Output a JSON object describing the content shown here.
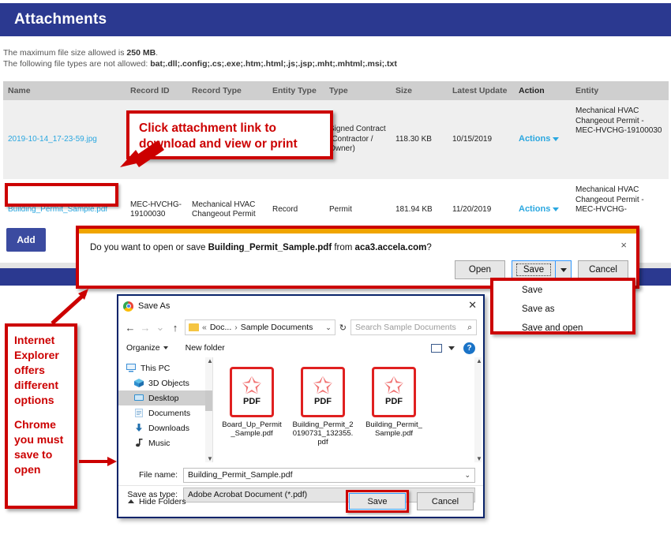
{
  "header": {
    "title": "Attachments"
  },
  "notice": {
    "line1_pre": "The maximum file size allowed is ",
    "line1_bold": "250 MB",
    "line1_post": ".",
    "line2_pre": "The following file types are not allowed: ",
    "line2_bold": "bat;.dll;.config;.cs;.exe;.htm;.html;.js;.jsp;.mht;.mhtml;.msi;.txt"
  },
  "table": {
    "columns": [
      "Name",
      "Record ID",
      "Record Type",
      "Entity Type",
      "Type",
      "Size",
      "Latest Update",
      "Action",
      "Entity"
    ],
    "rows": [
      {
        "name": "2019-10-14_17-23-59.jpg",
        "record_id": "",
        "record_type": "",
        "entity_type": "",
        "type": "Signed Contract (Contractor / Owner)",
        "size": "118.30 KB",
        "latest_update": "10/15/2019",
        "action": "Actions",
        "entity": "Mechanical HVAC Changeout Permit - MEC-HVCHG-19100030"
      },
      {
        "name": "Building_Permit_Sample.pdf",
        "record_id": "MEC-HVCHG-19100030",
        "record_type": "Mechanical HVAC Changeout Permit",
        "entity_type": "Record",
        "type": "Permit",
        "size": "181.94 KB",
        "latest_update": "11/20/2019",
        "action": "Actions",
        "entity": "Mechanical HVAC Changeout Permit - MEC-HVCHG-"
      }
    ]
  },
  "add_button": {
    "label": "Add"
  },
  "download_bar": {
    "message_pre": "Do you want to open or save ",
    "message_file": "Building_Permit_Sample.pdf",
    "message_mid": " from ",
    "message_host": "aca3.accela.com",
    "message_post": "?",
    "close_icon": "×",
    "open_label": "Open",
    "save_label": "Save",
    "cancel_label": "Cancel"
  },
  "save_menu": {
    "items": [
      "Save",
      "Save as",
      "Save and open"
    ]
  },
  "save_as": {
    "title": "Save As",
    "close_icon": "✕",
    "nav": {
      "back": "←",
      "forward": "→",
      "recent": "⌄",
      "up": "↑",
      "breadcrumb_sep1": "«",
      "breadcrumb_1": "Doc...",
      "breadcrumb_sep2": "›",
      "breadcrumb_2": "Sample Documents",
      "dropdown": "⌄",
      "refresh": "↻",
      "search_placeholder": "Search Sample Documents",
      "search_icon": "⌕"
    },
    "toolbar": {
      "organize": "Organize",
      "new_folder": "New folder",
      "help": "?"
    },
    "sidebar": [
      {
        "label": "This PC",
        "selected": false,
        "indent": false
      },
      {
        "label": "3D Objects",
        "selected": false,
        "indent": true
      },
      {
        "label": "Desktop",
        "selected": true,
        "indent": true
      },
      {
        "label": "Documents",
        "selected": false,
        "indent": true
      },
      {
        "label": "Downloads",
        "selected": false,
        "indent": true
      },
      {
        "label": "Music",
        "selected": false,
        "indent": true
      }
    ],
    "files": [
      {
        "name": "Board_Up_Permit_Sample.pdf",
        "badge": "PDF"
      },
      {
        "name": "Building_Permit_20190731_132355.pdf",
        "badge": "PDF"
      },
      {
        "name": "Building_Permit_Sample.pdf",
        "badge": "PDF"
      }
    ],
    "fields": {
      "file_name_label": "File name:",
      "file_name_value": "Building_Permit_Sample.pdf",
      "save_as_type_label": "Save as type:",
      "save_as_type_value": "Adobe Acrobat Document (*.pdf)"
    },
    "hide_folders": "Hide Folders",
    "save_label": "Save",
    "cancel_label": "Cancel"
  },
  "annotations": {
    "click_attachment": "Click attachment link to download and view or print",
    "ie_line1": "Internet",
    "ie_line2": "Explorer",
    "ie_line3": "offers",
    "ie_line4": "different",
    "ie_line5": "options",
    "ie_line6": "Chrome",
    "ie_line7": "you must",
    "ie_line8": "save to",
    "ie_line9": "open"
  },
  "colors": {
    "header_blue": "#2b3990",
    "link_blue": "#2aa7e0",
    "annotation_red": "#cc0000",
    "warning_orange": "#f0a500"
  }
}
